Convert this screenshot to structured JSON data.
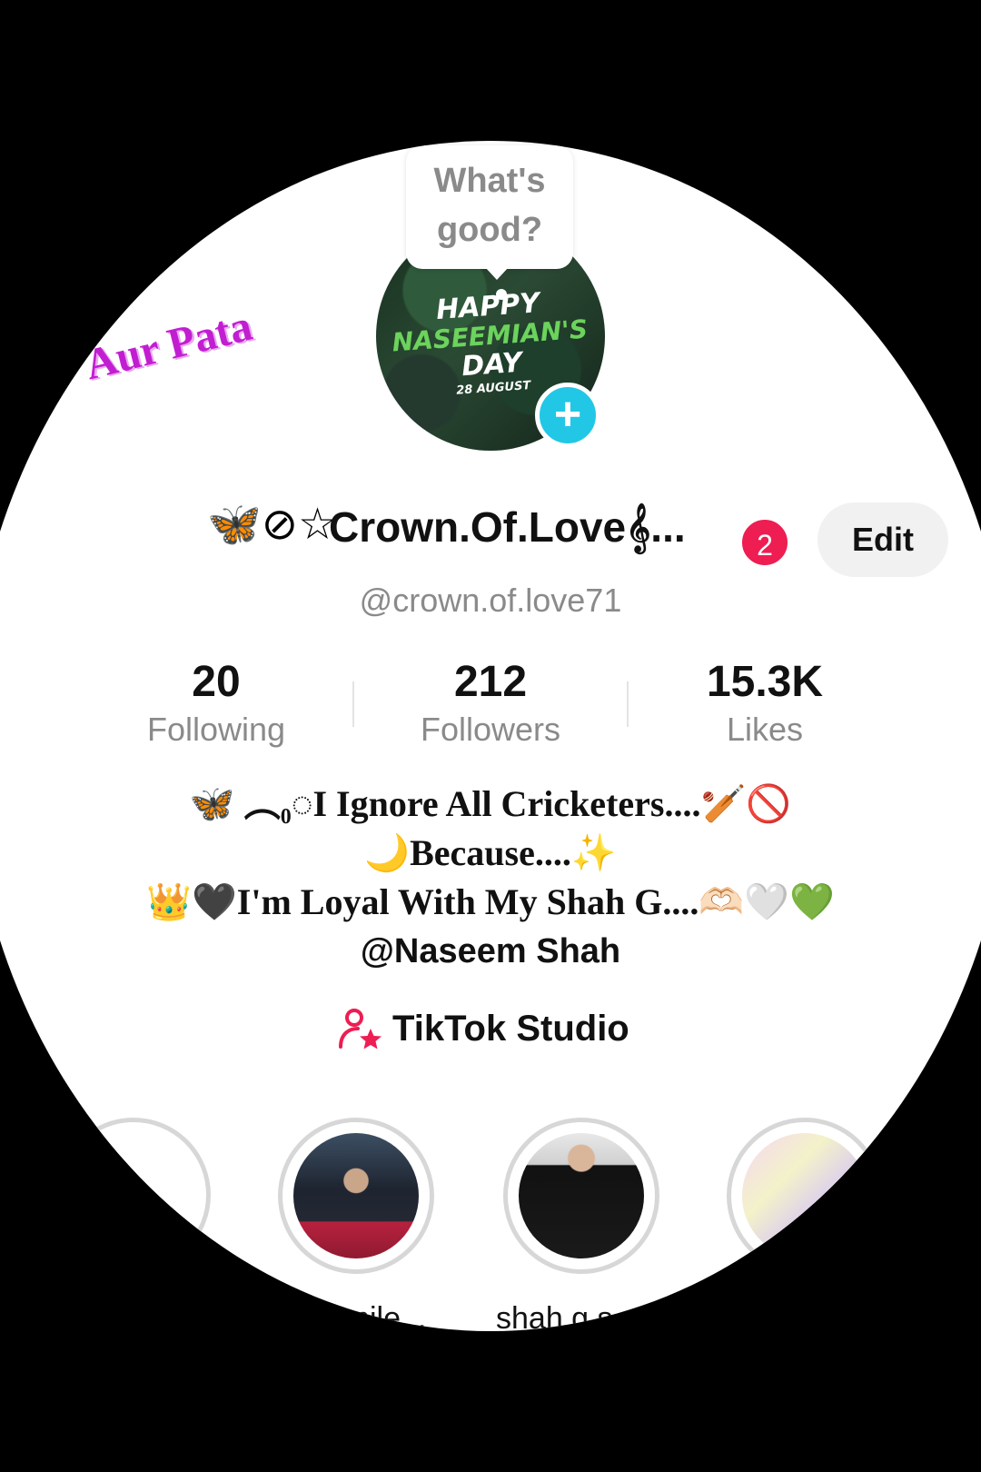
{
  "tooltip": {
    "line1": "What's",
    "line2": "good?"
  },
  "avatar": {
    "line1": "HAPPY",
    "line2": "NASEEMIAN'S",
    "line3": "DAY",
    "line4": "28 AUGUST",
    "add_symbol": "+"
  },
  "sticker_text": "Aur Pata",
  "profile": {
    "decoration": "🦋⊘☆",
    "display_name": "Crown.Of.Love𝄞...",
    "notification_count": "2",
    "edit_label": "Edit",
    "username": "@crown.of.love71"
  },
  "stats": [
    {
      "value": "20",
      "label": "Following"
    },
    {
      "value": "212",
      "label": "Followers"
    },
    {
      "value": "15.3K",
      "label": "Likes"
    }
  ],
  "bio": {
    "line1": "🦋 ︵₀◌I Ignore All Cricketers....🏏🚫",
    "line2": "🌙Because....✨",
    "line3": "👑🖤I'm Loyal With My Shah G....🫶🏻🤍💚",
    "line4": "@Naseem Shah"
  },
  "studio_label": "TikTok Studio",
  "highlights": {
    "new_symbol": "+",
    "items": [
      {
        "label": "Smile..."
      },
      {
        "label": "shah g s"
      },
      {
        "label": ""
      }
    ]
  },
  "colors": {
    "accent_pink": "#ee1d52",
    "story_add": "#22c7e6",
    "sticker": "#c21ed1"
  }
}
